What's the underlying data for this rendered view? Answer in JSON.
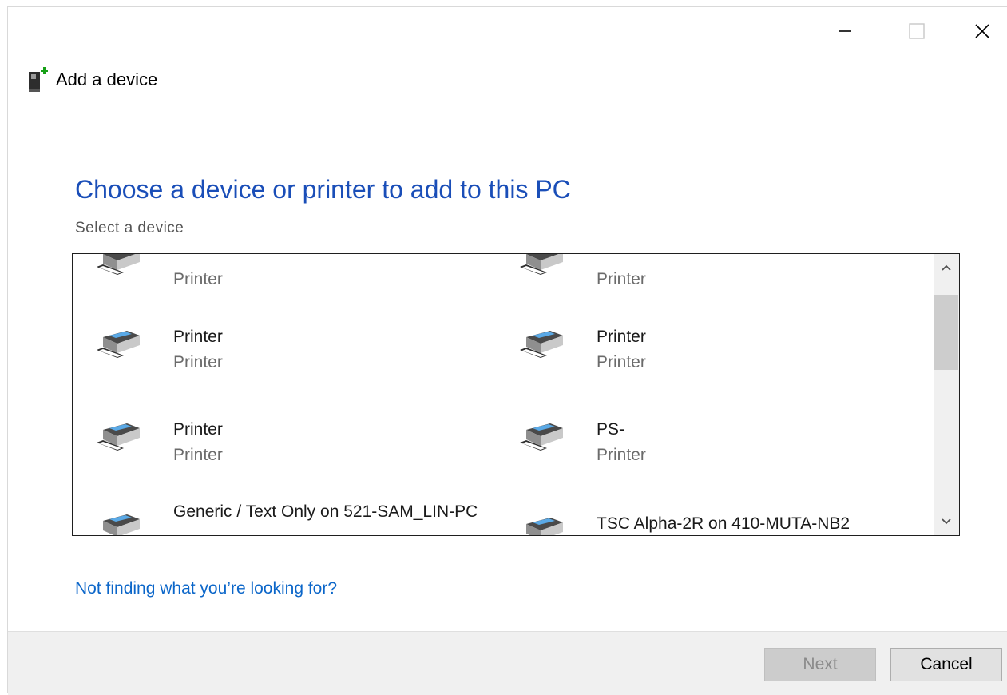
{
  "window": {
    "title": "Add a device",
    "controls": {
      "minimize": "minimize-icon",
      "maximize": "maximize-icon",
      "close": "close-icon"
    }
  },
  "main": {
    "heading": "Choose a device or printer to add to this PC",
    "subheading": "Select a device",
    "devices": [
      {
        "name": "",
        "type": "Printer"
      },
      {
        "name": "",
        "type": "Printer"
      },
      {
        "name": "Printer",
        "type": "Printer"
      },
      {
        "name": "Printer",
        "type": "Printer"
      },
      {
        "name": "Printer",
        "type": "Printer"
      },
      {
        "name": "PS-",
        "type": "Printer"
      },
      {
        "name": "Generic / Text Only on 521-SAM_LIN-PC",
        "type": ""
      },
      {
        "name": "TSC Alpha-2R on 410-MUTA-NB2",
        "type": ""
      }
    ],
    "help_link": "Not finding what you’re looking for?"
  },
  "footer": {
    "next_label": "Next",
    "cancel_label": "Cancel"
  },
  "colors": {
    "heading": "#1a4eb8",
    "link": "#0b66c9",
    "footer_bg": "#f0f0f0"
  }
}
